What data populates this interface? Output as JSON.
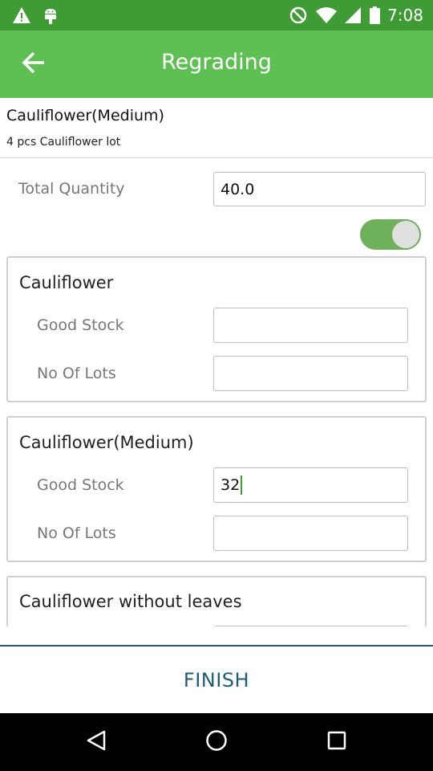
{
  "status_bar": {
    "time": "7:08",
    "icons": [
      "warning-icon",
      "android-icon",
      "do-not-disturb-icon",
      "wifi-icon",
      "signal-icon",
      "battery-icon"
    ]
  },
  "app_bar": {
    "title": "Regrading",
    "back_icon": "arrow-back-icon",
    "background": "#5ec053"
  },
  "product": {
    "name": "Cauliflower(Medium)",
    "subtitle": "4 pcs Cauliflower lot"
  },
  "total_quantity": {
    "label": "Total Quantity",
    "value": "40.0"
  },
  "toggle": {
    "on": true
  },
  "cards": [
    {
      "title": "Cauliflower",
      "good_stock_label": "Good Stock",
      "good_stock_value": "",
      "lots_label": "No Of Lots",
      "lots_value": ""
    },
    {
      "title": "Cauliflower(Medium)",
      "good_stock_label": "Good Stock",
      "good_stock_value": "32",
      "lots_label": "No Of Lots",
      "lots_value": ""
    },
    {
      "title": "Cauliflower without leaves"
    }
  ],
  "finish": {
    "label": "FINISH",
    "color": "#1f5c7a"
  },
  "nav_bar": {
    "icons": [
      "back-triangle-icon",
      "home-circle-icon",
      "recents-square-icon"
    ]
  }
}
